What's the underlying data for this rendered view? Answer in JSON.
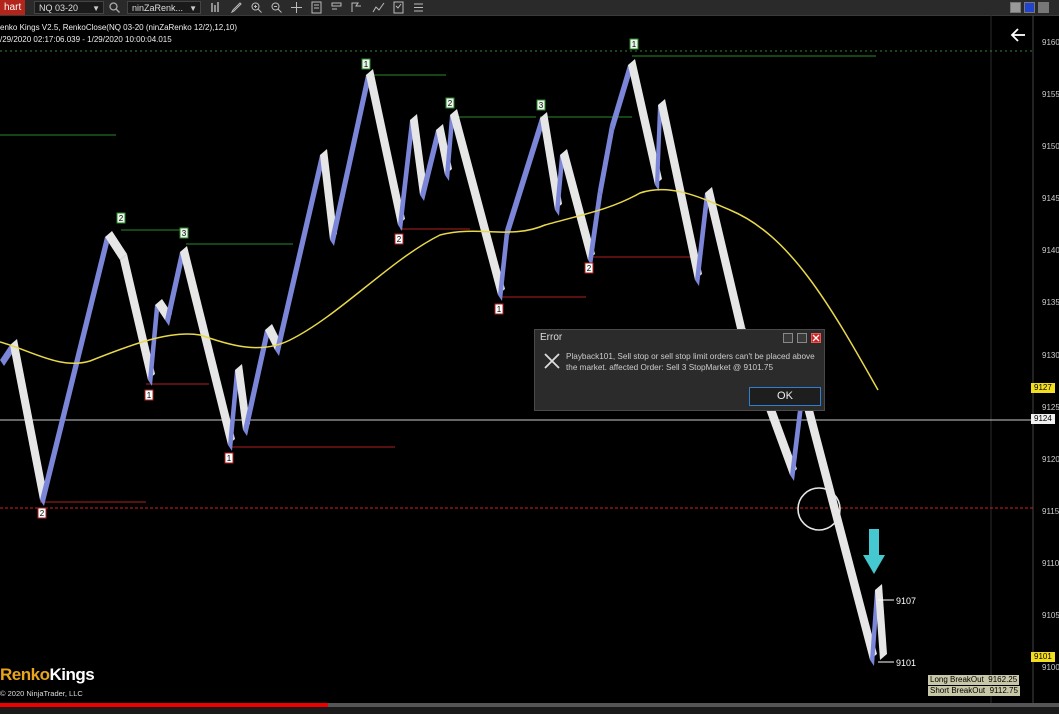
{
  "toolbar": {
    "tab_label": "hart",
    "instrument": "NQ 03-20",
    "template": "ninZaRenk..."
  },
  "chart_header": {
    "indicator_line": "enko Kings V2.5, RenkoClose(NQ 03-20 (ninZaRenko 12/2),12,10)",
    "time_range": "/29/2020 02:17:06.039 - 1/29/2020 10:00:04.015"
  },
  "axis": {
    "labels": [
      "9160",
      "9155",
      "9150",
      "9145",
      "9140",
      "9135",
      "9130",
      "9125",
      "9120",
      "9115",
      "9110",
      "9105",
      "9100"
    ],
    "price_tags": {
      "upper": "9127",
      "current": "9124",
      "lower": "9101"
    }
  },
  "swing_labels": [
    "1",
    "2",
    "3",
    "2",
    "3",
    "1",
    "2",
    "1",
    "2",
    "1",
    "1",
    "2",
    "1",
    "2"
  ],
  "level_labels": {
    "high": "9107",
    "low": "9101"
  },
  "error_dialog": {
    "title": "Error",
    "message": "Playback101, Sell stop or sell stop limit orders can't be placed above the market. affected Order: Sell 3 StopMarket @ 9101.75",
    "ok_label": "OK"
  },
  "breakout": {
    "long_label": "Long BreakOut",
    "long_value": "9162.25",
    "short_label": "Short BreakOut",
    "short_value": "9112.75"
  },
  "brand": {
    "part1": "Renko",
    "part2": "Kings"
  },
  "copyright": "2020 NinjaTrader, LLC",
  "playback_progress": 0.31,
  "colors": {
    "bull_brick": "#7c86d8",
    "bear_brick": "#e6e6e6",
    "ma_line": "#e8d94a",
    "red_level": "#e03030",
    "accent_arrow": "#45c8d0"
  }
}
